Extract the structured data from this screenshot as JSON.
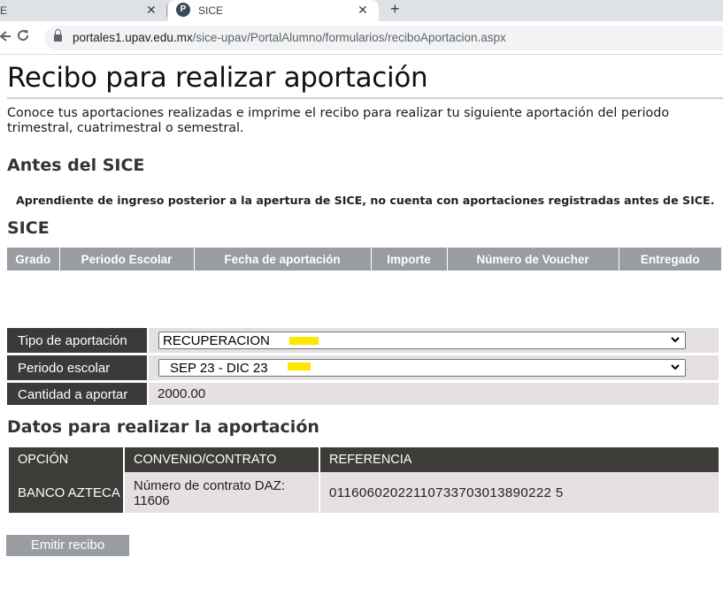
{
  "browser": {
    "prev_tab": {
      "title": "E",
      "close": "✕"
    },
    "active_tab": {
      "favicon": "P",
      "title": "SICE",
      "close": "✕"
    },
    "new_tab": "+",
    "url": {
      "host": "portales1.upav.edu.mx",
      "path": "/sice-upav/PortalAlumno/formularios/reciboAportacion.aspx"
    }
  },
  "page": {
    "title": "Recibo para realizar aportación",
    "intro": "Conoce tus aportaciones realizadas e imprime el recibo para realizar tu siguiente aportación del periodo trimestral, cuatrimestral o semestral."
  },
  "antes": {
    "heading": "Antes del SICE",
    "note": "Aprendiente de ingreso posterior a la apertura de SICE, no cuenta con aportaciones registradas antes de SICE."
  },
  "sice": {
    "heading": "SICE",
    "columns": [
      "Grado",
      "Periodo Escolar",
      "Fecha de aportación",
      "Importe",
      "Número de Voucher",
      "Entregado"
    ]
  },
  "form": {
    "tipo": {
      "label": "Tipo de aportación",
      "value": "RECUPERACION"
    },
    "periodo": {
      "label": "Periodo escolar",
      "value": "SEP 23 - DIC 23"
    },
    "cantidad": {
      "label": "Cantidad a aportar",
      "value": "2000.00"
    },
    "highlight_color": "#ffe600"
  },
  "datos": {
    "heading": "Datos para realizar la aportación",
    "columns": [
      "OPCIÓN",
      "CONVENIO/CONTRATO",
      "REFERENCIA"
    ],
    "rows": [
      {
        "opcion": "BANCO AZTECA",
        "convenio": "Número de contrato DAZ: 11606",
        "referencia": "01160602022110733703013890222 5"
      }
    ]
  },
  "actions": {
    "emit_label": "Emitir recibo"
  },
  "colors": {
    "header_gray": "#999da1",
    "label_dark": "#3a3a3a",
    "value_bg": "#e4e0e4"
  }
}
